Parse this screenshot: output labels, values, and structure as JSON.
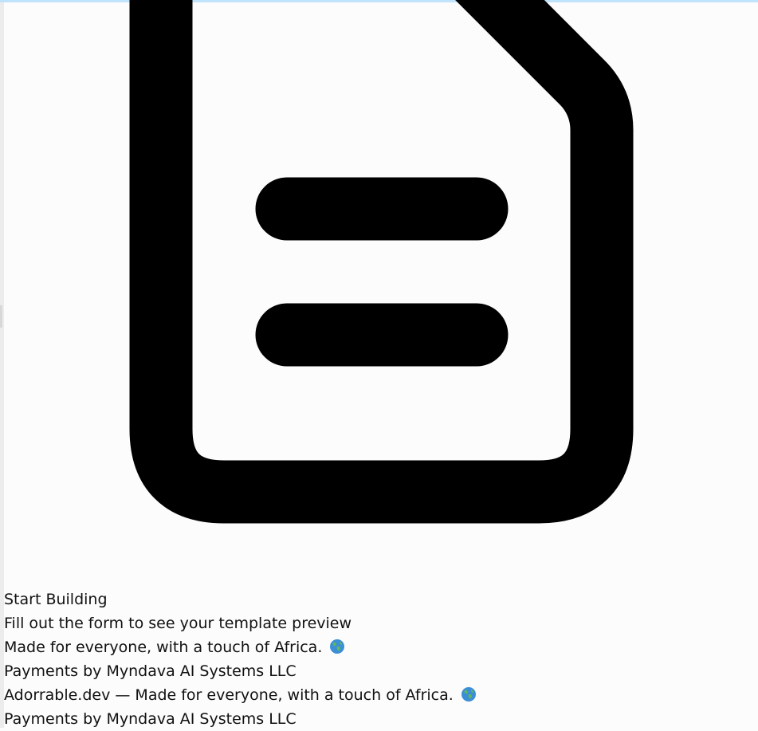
{
  "icons": {
    "document": "document-icon",
    "globe": "globe-icon"
  },
  "colors": {
    "background": "#fcfcfc",
    "top_strip": "#bfe3fb",
    "icon_stroke": "#000000",
    "text": "#111111"
  },
  "empty_state": {
    "title": "Start Building",
    "subtitle": "Fill out the form to see your template preview"
  },
  "footer_primary": {
    "tagline": "Made for everyone, with a touch of Africa.",
    "payments": "Payments by Myndava AI Systems LLC"
  },
  "footer_secondary": {
    "tagline": "Adorrable.dev — Made for everyone, with a touch of Africa.",
    "payments": "Payments by Myndava AI Systems LLC"
  }
}
